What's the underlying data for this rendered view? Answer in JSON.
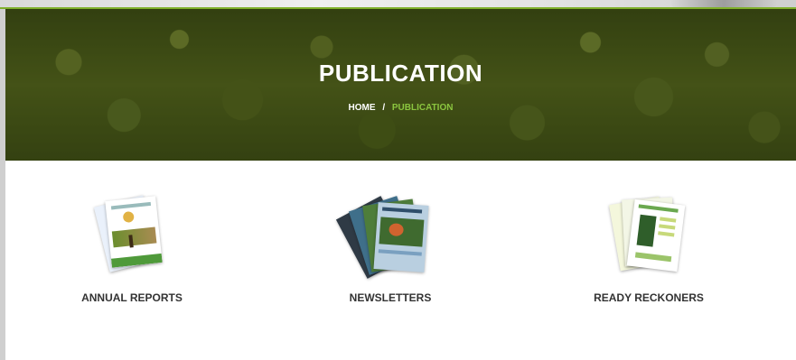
{
  "hero": {
    "title": "PUBLICATION",
    "breadcrumb": {
      "home": "HOME",
      "separator": "/",
      "current": "PUBLICATION"
    }
  },
  "publications": [
    {
      "label": "ANNUAL REPORTS",
      "icon": "annual-report-cover-icon"
    },
    {
      "label": "NEWSLETTERS",
      "icon": "newsletter-stack-icon"
    },
    {
      "label": "READY RECKONERS",
      "icon": "ready-reckoner-sheets-icon"
    }
  ],
  "colors": {
    "accent": "#8bc53f",
    "hero_overlay": "#3c4a15",
    "label": "#333333"
  }
}
